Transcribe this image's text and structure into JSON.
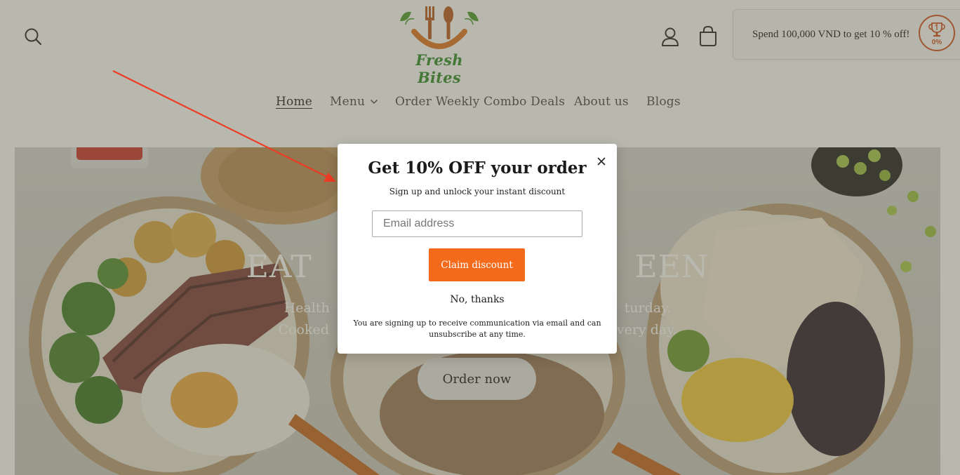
{
  "header": {
    "logo_text": "Fresh Bites",
    "search_icon": "search-icon",
    "account_icon": "user-icon",
    "cart_icon": "bag-icon"
  },
  "promo": {
    "text": "Spend 100,000 VND to get 10 % off!",
    "badge_text": "0%",
    "badge_icon": "trophy-icon",
    "progress_percent": 0,
    "accent_color": "#d24f1c"
  },
  "nav": {
    "items": [
      {
        "label": "Home",
        "active": true
      },
      {
        "label": "Menu",
        "has_dropdown": true
      },
      {
        "label": "Order Weekly Combo Deals"
      },
      {
        "label": "About us"
      },
      {
        "label": "Blogs"
      }
    ]
  },
  "hero": {
    "title_left": "EAT",
    "title_right": "EEN",
    "sub_left_1": "Health",
    "sub_right_1": "turday.",
    "sub_left_2": "Cooked",
    "sub_right_2": "very day.",
    "cta_label": "Order now"
  },
  "modal": {
    "title": "Get 10% OFF your order",
    "subtitle": "Sign up and unlock your instant discount",
    "email_placeholder": "Email address",
    "email_value": "",
    "claim_label": "Claim discount",
    "decline_label": "No, thanks",
    "legal_text": "You are signing up to receive communication via email and can unsubscribe at any time.",
    "close_icon": "close-icon",
    "accent_color": "#f36a1b"
  },
  "annotation": {
    "arrow_color": "#ee3b24"
  }
}
